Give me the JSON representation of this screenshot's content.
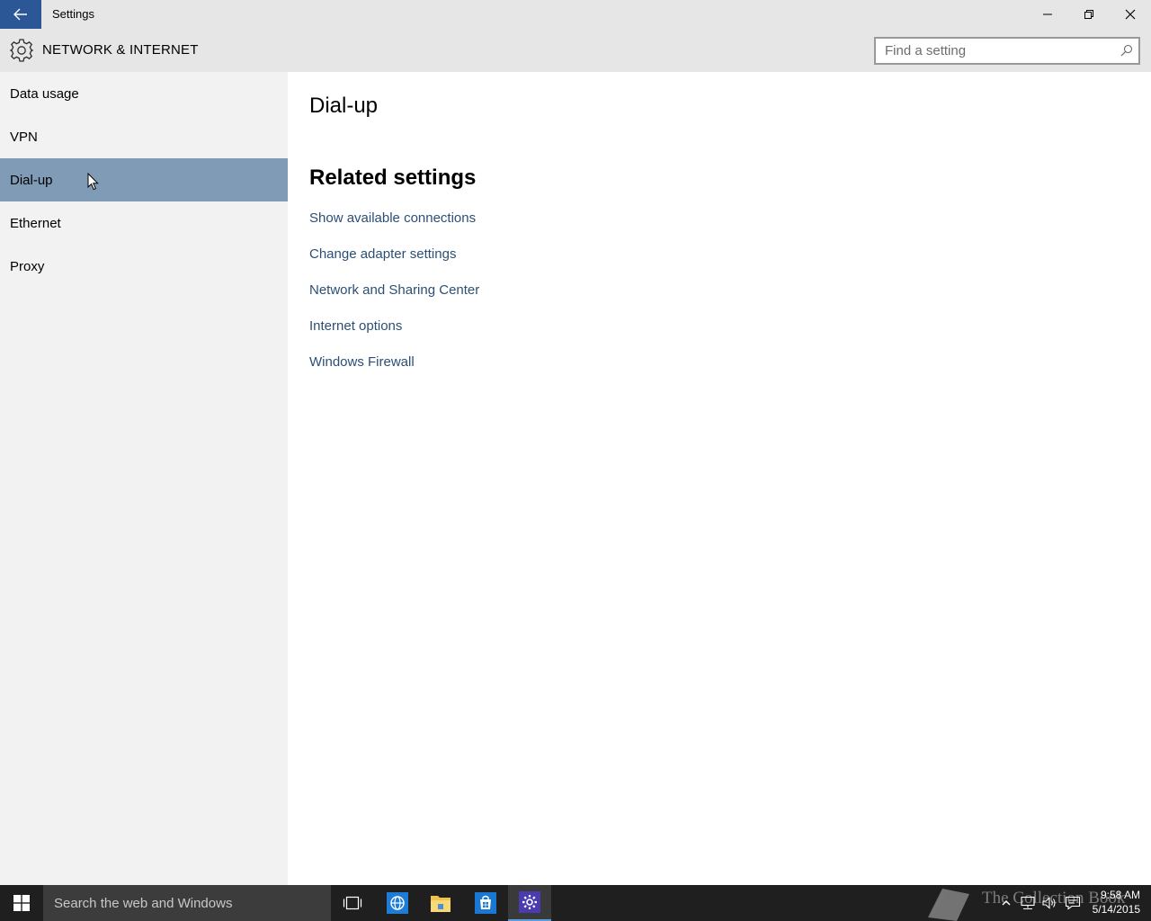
{
  "window": {
    "app_title": "Settings",
    "back_icon": "arrow-left-icon",
    "controls": [
      "minimize-icon",
      "restore-icon",
      "close-icon"
    ]
  },
  "header": {
    "section_title": "NETWORK & INTERNET",
    "section_icon": "gear-icon",
    "search_placeholder": "Find a setting"
  },
  "sidebar": {
    "items": [
      {
        "label": "Data usage",
        "active": false
      },
      {
        "label": "VPN",
        "active": false
      },
      {
        "label": "Dial-up",
        "active": true
      },
      {
        "label": "Ethernet",
        "active": false
      },
      {
        "label": "Proxy",
        "active": false
      }
    ],
    "active_color": "#7f9bb5"
  },
  "main": {
    "page_title": "Dial-up",
    "related_title": "Related settings",
    "links": [
      "Show available connections",
      "Change adapter settings",
      "Network and Sharing Center",
      "Internet options",
      "Windows Firewall"
    ],
    "link_color": "#2b4f77"
  },
  "taskbar": {
    "search_placeholder": "Search the web and Windows",
    "apps": [
      "task-view-icon",
      "internet-explorer-icon",
      "file-explorer-icon",
      "store-icon",
      "settings-icon"
    ],
    "tray": [
      "show-hidden-icons-icon",
      "network-icon",
      "volume-icon",
      "action-center-icon"
    ],
    "time": "9:58 AM",
    "date": "5/14/2015",
    "watermark": "The Collection Book"
  }
}
